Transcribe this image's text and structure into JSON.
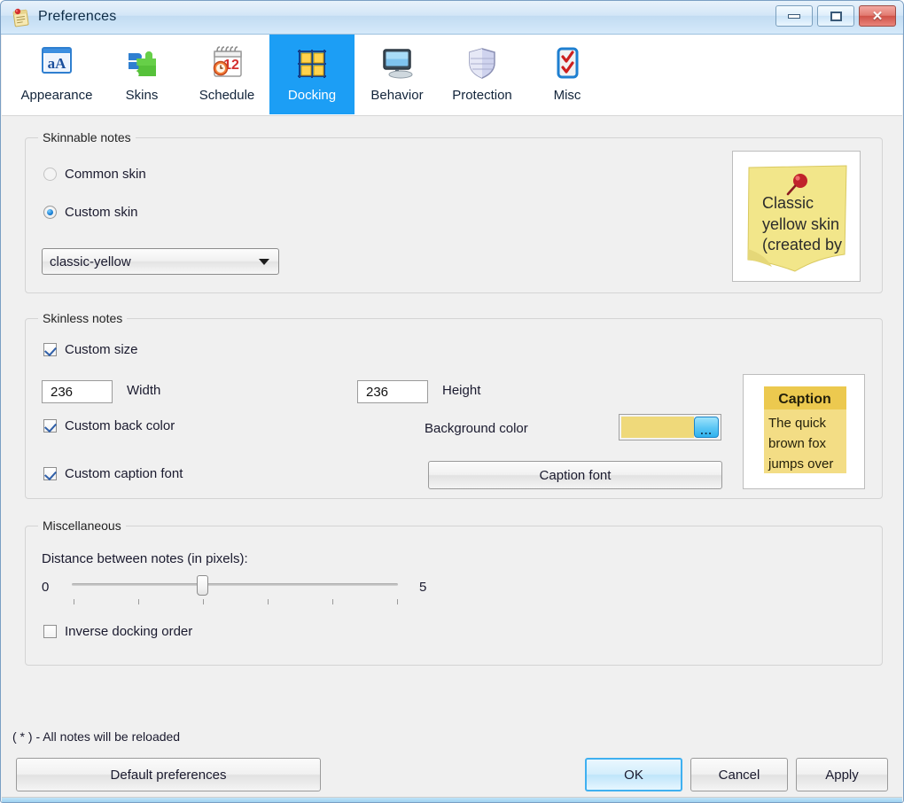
{
  "window": {
    "title": "Preferences",
    "icon": "notepad-pin-icon",
    "buttons": {
      "minimize": "minimize-icon",
      "maximize": "maximize-icon",
      "close": "close-icon"
    }
  },
  "toolbar": {
    "selected": "Docking",
    "tabs": [
      {
        "label": "Appearance",
        "icon": "appearance-window-a-icon"
      },
      {
        "label": "Skins",
        "icon": "puzzle-pieces-icon"
      },
      {
        "label": "Schedule",
        "icon": "calendar-clock-icon"
      },
      {
        "label": "Docking",
        "icon": "docking-grid-icon"
      },
      {
        "label": "Behavior",
        "icon": "monitor-icon"
      },
      {
        "label": "Protection",
        "icon": "shield-icon"
      },
      {
        "label": "Misc",
        "icon": "checklist-icon"
      }
    ]
  },
  "skinnable": {
    "legend": "Skinnable notes",
    "common_skin_label": "Common skin",
    "custom_skin_label": "Custom skin",
    "selected_option": "Custom skin",
    "skin_combo_value": "classic-yellow",
    "preview": {
      "name": "classic-yellow-note-preview",
      "line1": "Classic",
      "line2": "yellow skin",
      "line3": "(created by",
      "paper_color": "#f2e68a",
      "pin_color": "#c0232b"
    }
  },
  "skinless": {
    "legend": "Skinless notes",
    "custom_size_label": "Custom size",
    "custom_size_checked": true,
    "width_value": "236",
    "width_label": "Width",
    "height_value": "236",
    "height_label": "Height",
    "custom_back_color_label": "Custom back color",
    "custom_back_color_checked": true,
    "background_color_label": "Background color",
    "background_color_value": "#efd97a",
    "picker_button": "...",
    "custom_caption_font_label": "Custom caption font",
    "custom_caption_font_checked": true,
    "caption_font_button": "Caption font",
    "preview": {
      "name": "skinless-note-preview",
      "caption": "Caption",
      "line1": "The quick",
      "line2": "brown fox",
      "line3": "jumps over",
      "caption_bg": "#ecc94f",
      "body_bg": "#f3dd85"
    }
  },
  "misc": {
    "legend": "Miscellaneous",
    "distance_label": "Distance between notes (in pixels):",
    "slider_min_label": "0",
    "slider_max_label": "5",
    "slider_value": 2,
    "slider_min": 0,
    "slider_max": 5,
    "inverse_docking_label": "Inverse docking order",
    "inverse_docking_checked": false
  },
  "footer": {
    "note": "( * ) - All notes will be reloaded",
    "default_preferences": "Default preferences",
    "ok": "OK",
    "cancel": "Cancel",
    "apply": "Apply"
  }
}
